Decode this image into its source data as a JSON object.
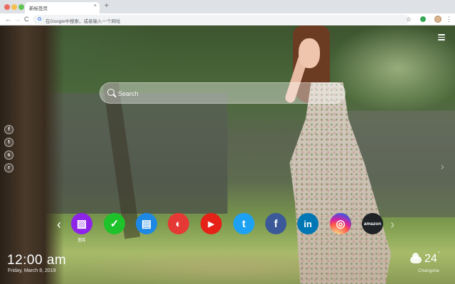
{
  "browser": {
    "tab_title": "新标签页",
    "tab_close": "×",
    "new_tab": "+",
    "back": "←",
    "forward": "→",
    "reload": "C",
    "omnibox_g": "G",
    "omnibox_placeholder": "在Google中搜索，或者输入一个网址",
    "bookmark_star": "☆",
    "menu_dots": "⋮"
  },
  "newtab": {
    "search_placeholder": "Search",
    "social": [
      {
        "icon": "facebook-icon",
        "glyph": "f"
      },
      {
        "icon": "twitter-icon",
        "glyph": "t"
      },
      {
        "icon": "snapchat-icon",
        "glyph": "s"
      },
      {
        "icon": "reddit-icon",
        "glyph": "r"
      }
    ],
    "prev_arrow": "‹",
    "next_arrow": "›",
    "side_arrow": "›",
    "shortcuts": [
      {
        "name": "gallery",
        "label": "图库",
        "glyph": "▨",
        "color": "#8e24e8"
      },
      {
        "name": "tasks",
        "label": "",
        "glyph": "✓",
        "color": "#1ec22a"
      },
      {
        "name": "news",
        "label": "",
        "glyph": "▤",
        "color": "#1e88e5"
      },
      {
        "name": "game",
        "label": "",
        "glyph": "◐",
        "color": "#e53935"
      },
      {
        "name": "youtube",
        "label": "",
        "glyph": "▶",
        "color": "#e62117"
      },
      {
        "name": "twitter",
        "label": "",
        "glyph": "t",
        "color": "#1da1f2"
      },
      {
        "name": "facebook",
        "label": "",
        "glyph": "f",
        "color": "#3b5998"
      },
      {
        "name": "linkedin",
        "label": "",
        "glyph": "in",
        "color": "#0077b5"
      },
      {
        "name": "instagram",
        "label": "",
        "glyph": "◎",
        "color": "#d6249f"
      },
      {
        "name": "amazon",
        "label": "",
        "glyph": "amazon",
        "color": "#1f2326"
      }
    ],
    "clock": "12:00 am",
    "date": "Friday, March 8, 2019",
    "temperature": "24",
    "degree": "°",
    "city": "Changsha"
  }
}
